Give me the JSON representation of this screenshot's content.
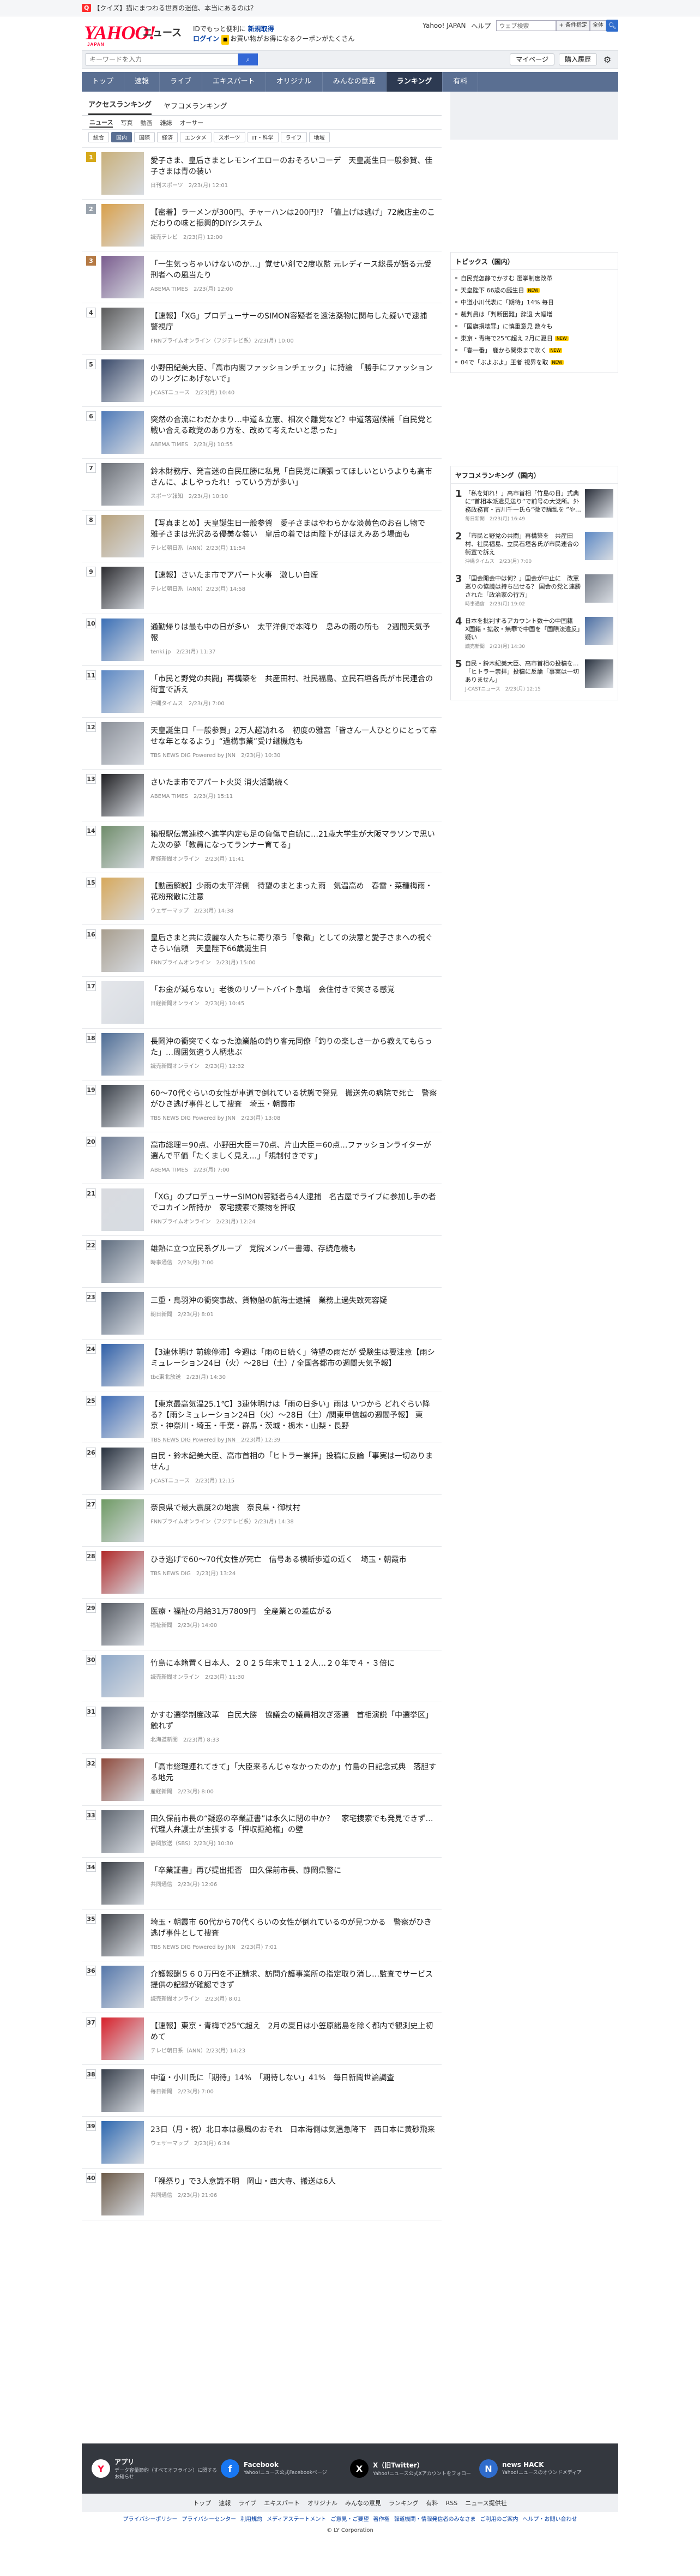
{
  "promo": {
    "badge": "Q",
    "text": "【クイズ】猫にまつわる世界の迷信、本当にあるのは？"
  },
  "header": {
    "logo": "YAHOO!",
    "logo_sub": "JAPAN",
    "brand": "ニュース",
    "line1_prefix": "IDでもっと便利に",
    "register": "新規取得",
    "login": "ログイン",
    "coupon_badge": "■",
    "coupon_text": "お買い物がお得になるクーポンがたくさん",
    "links": [
      "Yahoo! JAPAN",
      "ヘルプ"
    ],
    "search_placeholder": "ウェブ検索",
    "search_btn": "+ 条件指定",
    "all_btn": "全体"
  },
  "subbar": {
    "keyword_placeholder": "キーワードを入力",
    "mypage": "マイページ",
    "ebook": "購入履歴"
  },
  "nav": [
    "トップ",
    "速報",
    "ライブ",
    "エキスパート",
    "オリジナル",
    "みんなの意見",
    "ランキング",
    "有料"
  ],
  "nav_active": "ランキング",
  "tabs": [
    "アクセスランキング",
    "ヤフコメランキング"
  ],
  "categories": [
    "ニュース",
    "写真",
    "動画",
    "雑誌",
    "オーサー"
  ],
  "subcategories": [
    "総合",
    "国内",
    "国際",
    "経済",
    "エンタメ",
    "スポーツ",
    "IT・科学",
    "ライフ",
    "地域"
  ],
  "items": [
    {
      "rank": "1",
      "title": "愛子さま、皇后さまとレモンイエローのおそろいコーデ　天皇誕生日一般参賀、佳子さまは青の装い",
      "meta": "日刊スポーツ　2/23(月) 12:01",
      "color": "#c9b07a"
    },
    {
      "rank": "2",
      "title": "【密着】ラーメンが300円、チャーハンは200円!? 「値上げは逃げ」72歳店主のこだわりの味と振興的DIYシステム",
      "meta": "読売テレビ　2/23(月) 12:00",
      "color": "#d9a04a"
    },
    {
      "rank": "3",
      "title": "「一生気っちゃいけないのか…」覚せい剤で2度収監 元レディース総長が語る元受刑者への風当たり",
      "meta": "ABEMA TIMES　2/23(月) 12:00",
      "color": "#7a5c8e"
    },
    {
      "rank": "4",
      "title": "【速報】「XG」プロデューサーのSIMON容疑者を遠法薬物に関与した疑いで逮捕　警視庁",
      "meta": "FNNプライムオンライン（フジテレビ系）2/23(月) 10:00",
      "color": "#5a5a5a"
    },
    {
      "rank": "5",
      "title": "小野田紀美大臣、「高市内閣ファッションチェック」に持論　「勝手にファッションのリングにあげないで」",
      "meta": "J-CASTニュース　2/23(月) 10:40",
      "color": "#3a4a6a"
    },
    {
      "rank": "6",
      "title": "突然の合流にわだかまり…中道＆立憲、相次ぐ離党など？中道落選候補「自民党と戦い合える政党のあり方を、改めて考えたいと思った」",
      "meta": "ABEMA TIMES　2/23(月) 10:55",
      "color": "#4f7ab8"
    },
    {
      "rank": "7",
      "title": "鈴木財務庁、発言迷の自民圧勝に私見「自民党に頑張ってほしいというよりも高市さんに、よしやったれ！っていう方が多い」",
      "meta": "スポーツ報知　2/23(月) 10:10",
      "color": "#6a6e75"
    },
    {
      "rank": "8",
      "title": "【写真まとめ】天皇誕生日一般参賀　愛子さまはやわらかな淡黄色のお召し物で　雅子さまは光沢ある優美な装い　皇后の着では両陛下がほほえみあう場面も",
      "meta": "テレビ朝日系（ANN）2/23(月) 11:54",
      "color": "#b8a27c"
    },
    {
      "rank": "9",
      "title": "【速報】さいたま市でアパート火事　激しい白煙",
      "meta": "テレビ朝日系（ANN）2/23(月) 14:58",
      "color": "#2c2c30"
    },
    {
      "rank": "10",
      "title": "通勤帰りは最も中の日が多い　太平洋側で本降り　息みの雨の所も　2週間天気予報",
      "meta": "tenki.jp　2/23(月) 11:37",
      "color": "#3b6fb6"
    },
    {
      "rank": "11",
      "title": "「市民と野党の共闘」再構築を　共産田村、社民福島、立民石垣各氏が市民連合の街宣で訴え",
      "meta": "沖縄タイムス　2/23(月) 7:00",
      "color": "#5c88c4"
    },
    {
      "rank": "12",
      "title": "天皇誕生日「一般参賀」2万人超訪れる　初度の雅宮「皆さん一人ひとりにとって幸せな年となるよう」“過構事業”受け継機危も",
      "meta": "TBS NEWS DIG Powered by JNN　2/23(月) 10:30",
      "color": "#8a8f98"
    },
    {
      "rank": "13",
      "title": "さいたま市でアパート火災 消火活動続く",
      "meta": "ABEMA TIMES　2/23(月) 15:11",
      "color": "#1f1f22"
    },
    {
      "rank": "14",
      "title": "箱根駅伝常連校へ進学内定も足の負傷で自続に…21歳大学生が大阪マラソンで思いた次の夢「教員になってランナー育てる」",
      "meta": "産経新聞オンライン　2/23(月) 11:41",
      "color": "#6f8c6a"
    },
    {
      "rank": "15",
      "title": "【動画解説】少雨の太平洋側　待望のまとまった雨　気温高め　春雷・菜種梅雨・花粉飛散に注意",
      "meta": "ウェザーマップ　2/23(月) 14:38",
      "color": "#d7a85a"
    },
    {
      "rank": "16",
      "title": "皇后さまと共に涙麗な人たちに寄り添う「象徴」としての決意と愛子さまへの祝ぐさらい信頼　天皇陛下66歳誕生日",
      "meta": "FNNプライムオンライン　2/23(月) 15:00",
      "color": "#a89e8e"
    },
    {
      "rank": "17",
      "title": "「お金が減らない」老後のリゾートバイト急増　会住付きで笑さる感覚",
      "meta": "日経新聞オンライン　2/23(月) 10:45",
      "color": "#e4e6ea"
    },
    {
      "rank": "18",
      "title": "長岡沖の衝突でくなった漁業船の釣り客元同僚「釣りの楽しさ一から教えてもらった」…周囲気遣う人柄悲ぶ",
      "meta": "読売新聞オンライン　2/23(月) 12:32",
      "color": "#4d6c95"
    },
    {
      "rank": "19",
      "title": "60～70代ぐらいの女性が車道で倒れている状態で発見　搬送先の病院で死亡　警察がひき逃げ事件として捜査　埼玉・朝霞市",
      "meta": "TBS NEWS DIG Powered by JNN　2/23(月) 13:08",
      "color": "#3a4048"
    },
    {
      "rank": "20",
      "title": "高市総理＝90点、小野田大臣＝70点、片山大臣＝60点…ファッションライターが選んで平価「たくましく見え…」「規制付きです」",
      "meta": "ABEMA TIMES　2/23(月) 7:00",
      "color": "#6e7b92"
    },
    {
      "rank": "21",
      "title": "「XG」のプロデューサーSIMON容疑者ら4人逮捕　名古屋でライブに参加し手の者でコカイン所持か　家宅捜索で薬物を押収",
      "meta": "FNNプライムオンライン　2/23(月) 12:24",
      "color": "#d9dbe0"
    },
    {
      "rank": "22",
      "title": "雄熱に立つ立民系グループ　党院メンバー書簿、存続危機も",
      "meta": "時事通信　2/23(月) 7:00",
      "color": "#5e6c7e"
    },
    {
      "rank": "23",
      "title": "三重・鳥羽沖の衝突事故、貨物船の航海士逮捕　業務上過失致死容疑",
      "meta": "朝日新聞　2/23(月) 8:01",
      "color": "#56657a"
    },
    {
      "rank": "24",
      "title": "【3連休明け 前線停滞】今週は「雨の日続く」待望の雨だが 受験生は要注意【雨シミュレーション24日（火）〜28日（土）/ 全国各都市の週間天気予報】",
      "meta": "tbc東北放送　2/23(月) 14:30",
      "color": "#2f5fa8"
    },
    {
      "rank": "25",
      "title": "【東京最高気温25.1℃】3連休明けは「雨の日多い」雨は いつから どれぐらい降る?【雨シミュレーション24日（火）〜28日（土）/関東甲信越の週間予報】 東京・神奈川・埼玉・千葉・群馬・茨城・栃木・山梨・長野",
      "meta": "TBS NEWS DIG Powered by JNN　2/23(月) 12:39",
      "color": "#3d6bb5"
    },
    {
      "rank": "26",
      "title": "自民・鈴木紀美大臣、高市首相の「ヒトラー崇拝」投稿に反論「事実は一切ありません」",
      "meta": "J-CASTニュース　2/23(月) 12:15",
      "color": "#27303d"
    },
    {
      "rank": "27",
      "title": "奈良県で最大震度2の地震　奈良県・御杖村",
      "meta": "FNNプライムオンライン（フジテレビ系）2/23(月) 14:38",
      "color": "#6f9a64"
    },
    {
      "rank": "28",
      "title": "ひき逃げで60〜70代女性が死亡　信号ある横断歩道の近く　埼玉・朝霞市",
      "meta": "TBS NEWS DIG　2/23(月) 13:24",
      "color": "#b12a2a"
    },
    {
      "rank": "29",
      "title": "医療・福祉の月給31万7809円　全産業との差広がる",
      "meta": "福祉新聞　2/23(月) 14:00",
      "color": "#555a62"
    },
    {
      "rank": "30",
      "title": "竹島に本籍置く日本人、２０２５年末で１１２人…２０年で４・３倍に",
      "meta": "読売新聞オンライン　2/23(月) 11:30",
      "color": "#8ea8c8"
    },
    {
      "rank": "31",
      "title": "かすむ選挙制度改革　自民大勝　協議会の議員相次ぎ落選　首相演説「中選挙区」触れず",
      "meta": "北海道新聞　2/23(月) 8:33",
      "color": "#6b7484"
    },
    {
      "rank": "32",
      "title": "「高市総理連れてきて」「大臣来るんじゃなかったのか」竹島の日記念式典　落胆する地元",
      "meta": "産経新聞　2/23(月) 8:00",
      "color": "#8e4a3c"
    },
    {
      "rank": "33",
      "title": "田久保前市長の“疑惑の卒業証書”は永久に閉の中か？　家宅捜索でも発見できず…代理人弁護士が主張する「押収拒絶権」の壁",
      "meta": "静岡放送（SBS）2/23(月) 10:30",
      "color": "#5f6670"
    },
    {
      "rank": "34",
      "title": "「卒業証書」再び提出拒否　田久保前市長、静岡県警に",
      "meta": "共同通信　2/23(月) 12:06",
      "color": "#3b3f46"
    },
    {
      "rank": "35",
      "title": "埼玉・朝霞市 60代から70代くらいの女性が倒れているのが見つかる　警察がひき逃げ事件として捜査",
      "meta": "TBS NEWS DIG Powered by JNN　2/23(月) 7:01",
      "color": "#44474d"
    },
    {
      "rank": "36",
      "title": "介護報酬５６０万円を不正請求、訪問介護事業所の指定取り消し…監査でサービス提供の記録が確認できず",
      "meta": "読売新聞オンライン　2/23(月) 8:01",
      "color": "#5577aa"
    },
    {
      "rank": "37",
      "title": "【速報】東京・青梅で25℃超え　2月の夏日は小笠原諸島を除く都内で観測史上初めて",
      "meta": "テレビ朝日系（ANN）2/23(月) 14:23",
      "color": "#d8202a"
    },
    {
      "rank": "38",
      "title": "中道・小川氏に「期待」14%　「期待しない」41%　毎日新聞世論調査",
      "meta": "毎日新聞　2/23(月) 7:00",
      "color": "#38404c"
    },
    {
      "rank": "39",
      "title": "23日（月・祝）北日本は暴風のおそれ　日本海側は気温急降下　西日本に黄砂飛来",
      "meta": "ウェザーマップ　2/23(月) 6:34",
      "color": "#2e68b0"
    },
    {
      "rank": "40",
      "title": "「裸祭り」で3人意識不明　岡山・西大寺、搬送は6人",
      "meta": "共同通信　2/23(月) 21:06",
      "color": "#6c5a48"
    }
  ],
  "sidebar": {
    "topics_title": "トピックス（国内）",
    "topics": [
      {
        "text": "自民党怎静でかすむ 選挙制度改革",
        "new": ""
      },
      {
        "text": "天皇陛下 66歳の誕生日",
        "new": "NEW"
      },
      {
        "text": "中道小川代表に「期待」14% 毎日",
        "new": ""
      },
      {
        "text": "裁判員は「判断困難」辞退 大幅増",
        "new": ""
      },
      {
        "text": "「国旗損壊罪」に慎重意見 数々も",
        "new": ""
      },
      {
        "text": "東京・青梅で25℃超え 2月に夏日",
        "new": "NEW"
      },
      {
        "text": "「春一番」 鹿から関東まで吹く",
        "new": "NEW"
      },
      {
        "text": "04で「ぶよぶよ」王者 視界を取",
        "new": "NEW"
      }
    ],
    "rank_title": "ヤフコメランキング（国内）",
    "ranks": [
      {
        "n": "1",
        "text": "「私を知れ！」高市首相「竹島の日」式典に“首相本派遣見送り”で前号の大党所。外務政務官・古川千一氏ら“微で騒乱を ”やるやる詐欺",
        "meta": "毎日新聞　2/23(月) 16:49",
        "color": "#2a2f3a"
      },
      {
        "n": "2",
        "text": "「市民と野党の共闘」再構築を　共産田村、社民福島、立民石垣各氏が市民連合の街宣で訴え",
        "meta": "沖縄タイムス　2/23(月) 7:00",
        "color": "#5c88c4"
      },
      {
        "n": "3",
        "text": "「国会開会中は何？」国会が中止に　改憲巡りの協議は持ち出せる？ 国会の党と連勝された「政治家の行方」",
        "meta": "時事通信　2/23(月) 19:02",
        "color": "#777e8a"
      },
      {
        "n": "4",
        "text": "日本を批判するアカウント数十の中国籍　X国籍・拡散・無罪で中国を「国際法違反」疑い",
        "meta": "読売新聞　2/23(月) 14:30",
        "color": "#4b6ea3"
      },
      {
        "n": "5",
        "text": "自民・鈴木紀美大臣、高市首相の投稿を...「ヒトラー崇拝」投稿に反論「事実は一切ありません」",
        "meta": "J-CASTニュース　2/23(月) 12:15",
        "color": "#27303d"
      }
    ]
  },
  "footer": {
    "cols": [
      {
        "label": "アプリ",
        "sub": "データ容量節約（すべてオフライン）に関するお知らせ",
        "icon": "Y",
        "color": "#ffffff",
        "fg": "#ff0033"
      },
      {
        "label": "Facebook",
        "sub": "Yahoo!ニュース公式Facebookページ",
        "icon": "f",
        "color": "#1877f2",
        "fg": "#ffffff"
      },
      {
        "label": "X（旧Twitter）",
        "sub": "Yahoo!ニュース公式Xアカウントをフォロー",
        "icon": "X",
        "color": "#000000",
        "fg": "#ffffff"
      },
      {
        "label": "news HACK",
        "sub": "Yahoo!ニュースのオウンドメディア",
        "icon": "N",
        "color": "#2f6ccc",
        "fg": "#ffffff"
      }
    ],
    "links": [
      "トップ",
      "速報",
      "ライブ",
      "エキスパート",
      "オリジナル",
      "みんなの意見",
      "ランキング",
      "有料",
      "RSS",
      "ニュース提供社"
    ],
    "links2": [
      "プライバシーポリシー",
      "プライバシーセンター",
      "利用規約",
      "メディアステートメント",
      "ご意見・ご要望",
      "著作権",
      "報道機関・情報発信者のみなさま",
      "ご利用のご案内",
      "ヘルプ・お問い合わせ"
    ],
    "copyright": "© LY Corporation"
  }
}
